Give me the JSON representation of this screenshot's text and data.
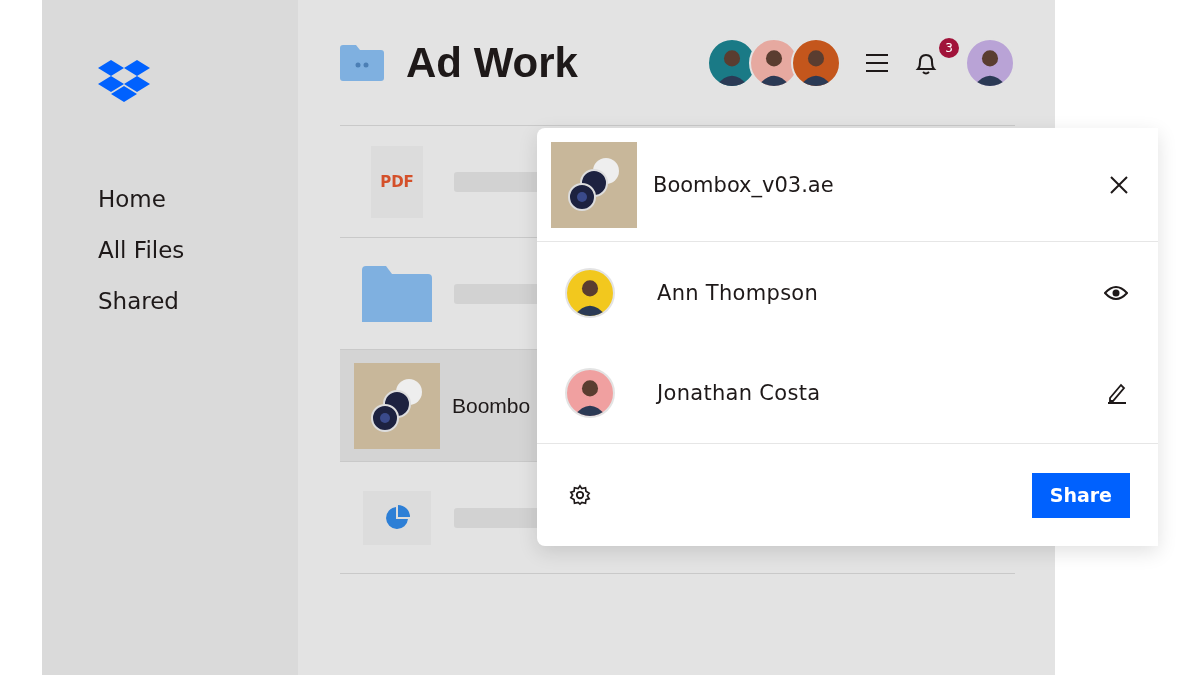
{
  "sidebar": {
    "items": [
      {
        "label": "Home",
        "selected": false
      },
      {
        "label": "All Files",
        "selected": false
      },
      {
        "label": "Shared",
        "selected": false
      }
    ]
  },
  "header": {
    "title": "Ad Work",
    "collaborators": [
      {
        "color": "#1a7a86"
      },
      {
        "color": "#e6a9a0"
      },
      {
        "color": "#c4561c"
      }
    ],
    "notifications": "3"
  },
  "files": [
    {
      "kind": "pdf",
      "icon_text": "PDF",
      "selected": false
    },
    {
      "kind": "folder",
      "selected": false
    },
    {
      "kind": "image",
      "name": "Boombo",
      "selected": true
    },
    {
      "kind": "chart",
      "selected": false
    }
  ],
  "share_dialog": {
    "file_name": "Boombox_v03.ae",
    "members": [
      {
        "name": "Ann Thompson",
        "color": "#f2c81e",
        "kind": "view"
      },
      {
        "name": "Jonathan Costa",
        "color": "#f0a0a0",
        "kind": "edit"
      }
    ],
    "button": "Share"
  }
}
